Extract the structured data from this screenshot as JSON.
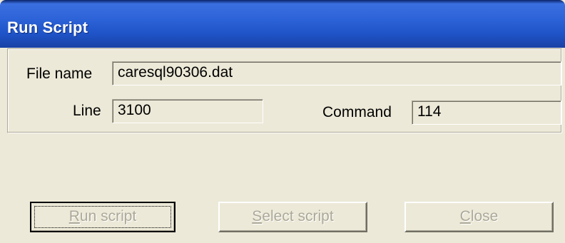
{
  "window": {
    "title": "Run Script"
  },
  "fields": {
    "file_name": {
      "label": "File name",
      "value": "caresql90306.dat"
    },
    "line": {
      "label": "Line",
      "value": "3100"
    },
    "command": {
      "label": "Command",
      "value": "114"
    }
  },
  "buttons": {
    "run_script": {
      "accel": "R",
      "rest": "un script",
      "enabled": false
    },
    "select_script": {
      "accel": "S",
      "rest": "elect script",
      "enabled": false
    },
    "close": {
      "accel": "C",
      "rest": "lose",
      "enabled": false
    }
  },
  "colors": {
    "titlebar": "#2d63d8",
    "dialog_bg": "#ece9d8",
    "disabled_text": "#aca899"
  }
}
